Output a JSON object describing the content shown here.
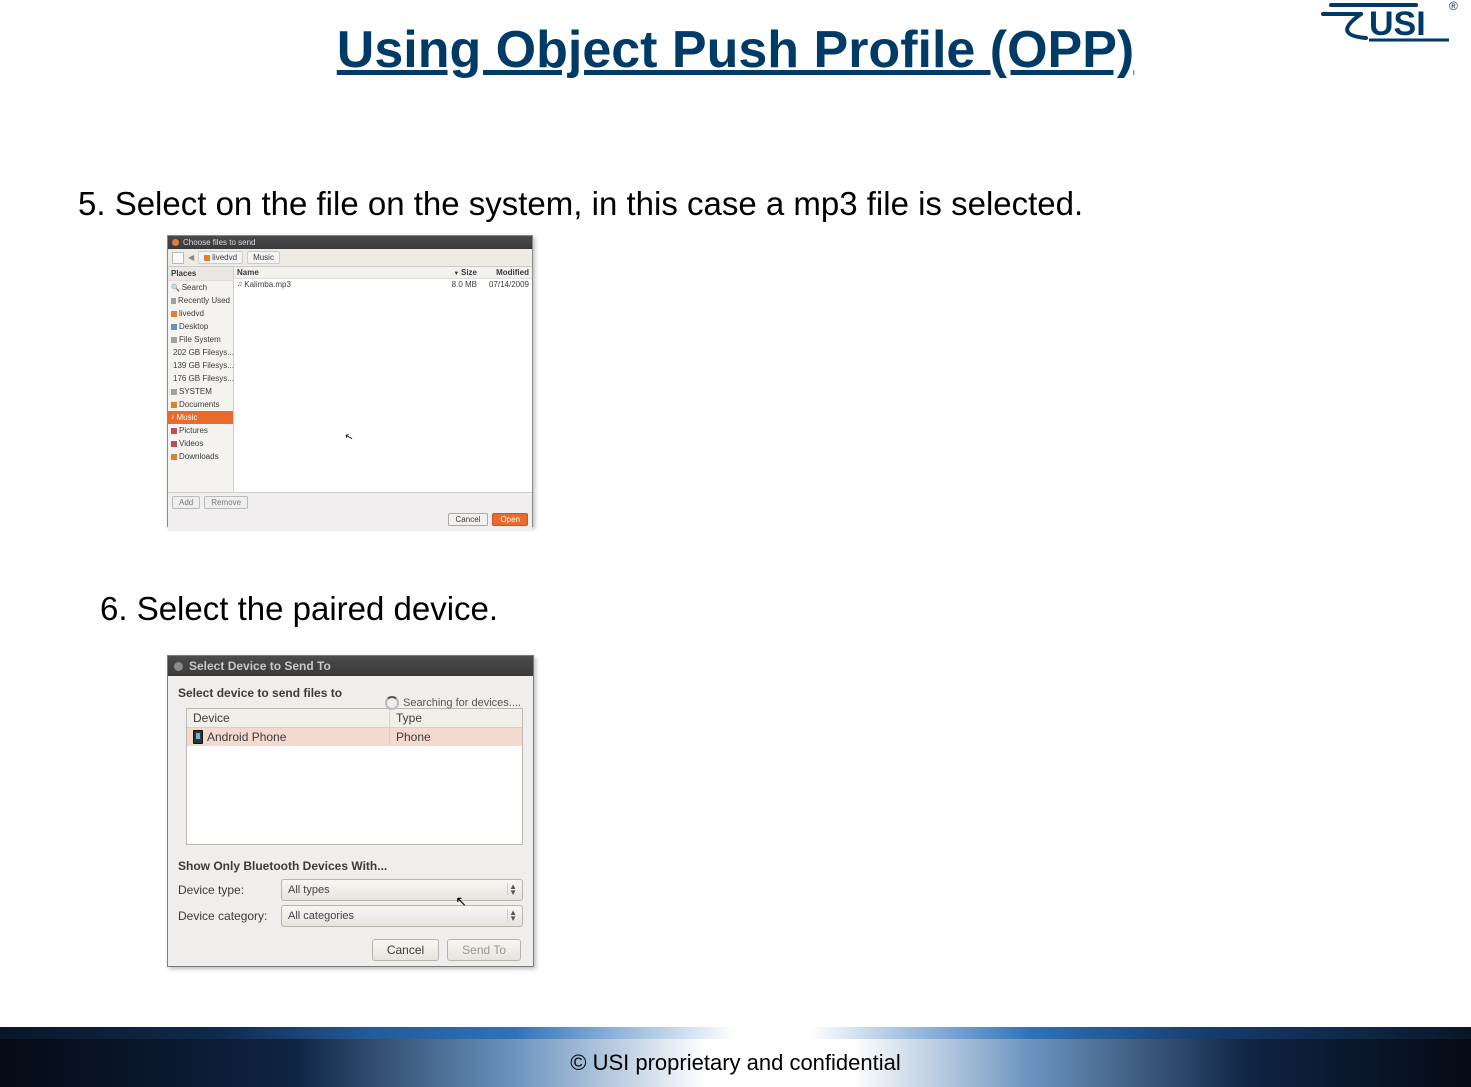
{
  "title": "Using Object Push Profile (OPP)",
  "logo_text": "USI",
  "step5": "5. Select on the file on the system, in this case a mp3 file is selected.",
  "step6": "6. Select the paired device.",
  "footer": "© USI proprietary and confidential",
  "dlg1": {
    "title": "Choose files to send",
    "crumb_user": "livedvd",
    "crumb_folder": "Music",
    "places_header": "Places",
    "places": {
      "search": "Search",
      "recent": "Recently Used",
      "home": "livedvd",
      "desktop": "Desktop",
      "filesystem": "File System",
      "vol1": "202 GB Filesys...",
      "vol2": "139 GB Filesys...",
      "vol3": "176 GB Filesys...",
      "system": "SYSTEM",
      "documents": "Documents",
      "music": "Music",
      "pictures": "Pictures",
      "videos": "Videos",
      "downloads": "Downloads"
    },
    "cols": {
      "name": "Name",
      "size": "Size",
      "modified": "Modified"
    },
    "file": {
      "name": "Kalimba.mp3",
      "size": "8.0 MB",
      "modified": "07/14/2009"
    },
    "btn_add": "Add",
    "btn_remove": "Remove",
    "btn_cancel": "Cancel",
    "btn_open": "Open"
  },
  "dlg2": {
    "title": "Select Device to Send To",
    "subtitle": "Select device to send files to",
    "searching": "Searching for devices....",
    "col_device": "Device",
    "col_type": "Type",
    "row_device": "Android Phone",
    "row_type": "Phone",
    "filter_header": "Show Only Bluetooth Devices With...",
    "lbl_type": "Device type:",
    "val_type": "All types",
    "lbl_cat": "Device category:",
    "val_cat": "All categories",
    "btn_cancel": "Cancel",
    "btn_send": "Send To"
  }
}
